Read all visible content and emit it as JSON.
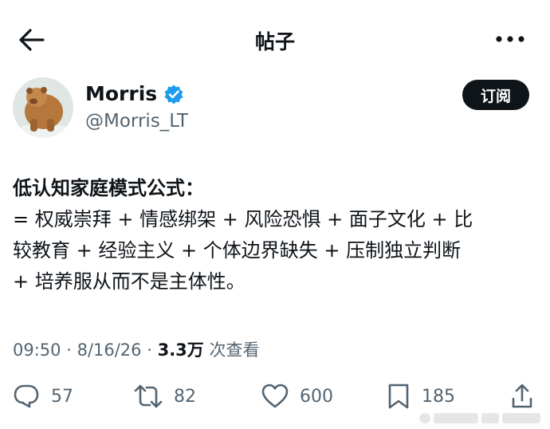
{
  "header": {
    "title": "帖子"
  },
  "author": {
    "name": "Morris",
    "handle": "@Morris_LT",
    "follow_label": "订阅"
  },
  "post": {
    "lines": [
      "低认知家庭模式公式：",
      "= 权威崇拜 + 情感绑架 + 风险恐惧 + 面子文化 + 比",
      "较教育 + 经验主义 + 个体边界缺失 + 压制独立判断",
      "+ 培养服从而不是主体性。"
    ],
    "time": "09:50",
    "date": "8/16/26",
    "views": "3.3万",
    "views_suffix": "次查看"
  },
  "actions": {
    "replies": "57",
    "reposts": "82",
    "likes": "600",
    "bookmarks": "185"
  },
  "colors": {
    "text": "#0f1419",
    "secondary": "#536471",
    "verified": "#1d9bf0",
    "follow_bg": "#0f1419"
  },
  "icons": [
    "arrow-left-icon",
    "more-dots-icon",
    "verified-badge-icon",
    "reply-icon",
    "repost-icon",
    "like-icon",
    "bookmark-icon",
    "share-icon"
  ]
}
